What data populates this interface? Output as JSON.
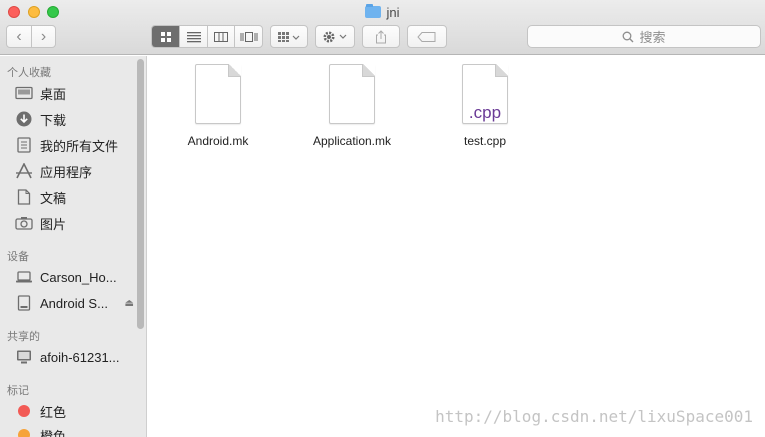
{
  "window": {
    "title": "jni"
  },
  "toolbar": {
    "search_placeholder": "搜索"
  },
  "sidebar": {
    "favorites_heading": "个人收藏",
    "favorites": [
      {
        "label": "桌面",
        "icon": "desktop-icon"
      },
      {
        "label": "下载",
        "icon": "download-icon"
      },
      {
        "label": "我的所有文件",
        "icon": "all-files-icon"
      },
      {
        "label": "应用程序",
        "icon": "applications-icon"
      },
      {
        "label": "文稿",
        "icon": "documents-icon"
      },
      {
        "label": "图片",
        "icon": "camera-icon"
      }
    ],
    "devices_heading": "设备",
    "devices": [
      {
        "label": "Carson_Ho...",
        "icon": "laptop-icon"
      },
      {
        "label": "Android S...",
        "icon": "drive-icon"
      }
    ],
    "shared_heading": "共享的",
    "shared": [
      {
        "label": "afoih-61231...",
        "icon": "monitor-icon"
      }
    ],
    "tags_heading": "标记",
    "tags": [
      {
        "label": "红色",
        "color": "#f25a55"
      },
      {
        "label": "橙色",
        "color": "#f6a33a"
      }
    ]
  },
  "files": [
    {
      "name": "Android.mk",
      "badge": ""
    },
    {
      "name": "Application.mk",
      "badge": ""
    },
    {
      "name": "test.cpp",
      "badge": ".cpp"
    }
  ],
  "watermark": "http://blog.csdn.net/lixuSpace001"
}
